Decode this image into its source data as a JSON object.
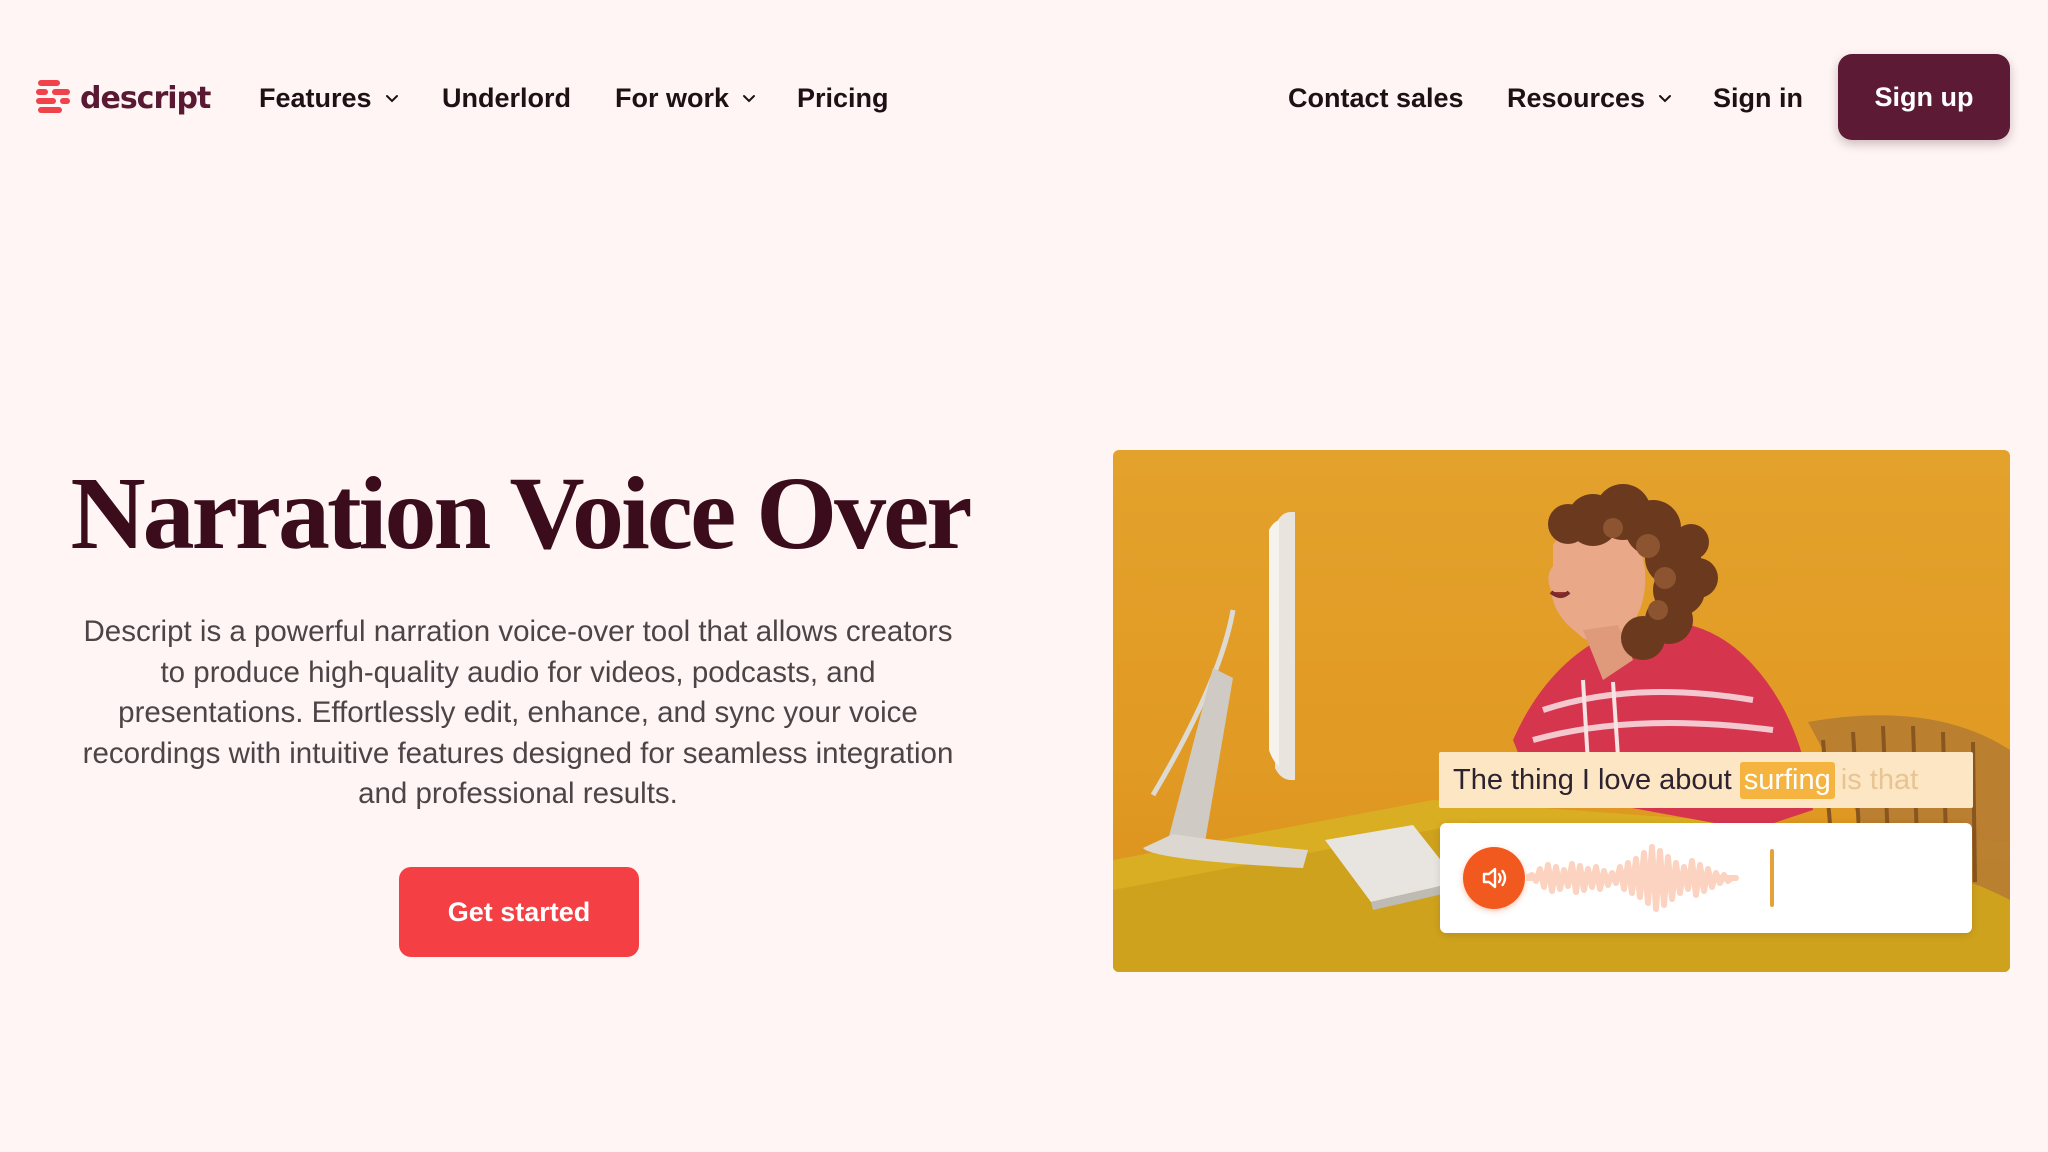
{
  "brand": {
    "name": "descript"
  },
  "nav": {
    "left": [
      {
        "label": "Features",
        "dropdown": true
      },
      {
        "label": "Underlord",
        "dropdown": false
      },
      {
        "label": "For work",
        "dropdown": true
      },
      {
        "label": "Pricing",
        "dropdown": false
      }
    ],
    "right": [
      {
        "label": "Contact sales",
        "dropdown": false
      },
      {
        "label": "Resources",
        "dropdown": true
      },
      {
        "label": "Sign in",
        "dropdown": false
      }
    ],
    "signup_label": "Sign up"
  },
  "hero": {
    "title": "Narration Voice Over",
    "description_lines": [
      "Descript is a powerful narration voice-over tool that allows creators",
      "to produce high-quality audio for videos, podcasts, and",
      "presentations. Effortlessly edit, enhance, and sync your voice",
      "recordings with intuitive features designed for seamless integration",
      "and professional results."
    ],
    "cta_label": "Get started"
  },
  "media": {
    "caption": {
      "spoken": [
        "The",
        "thing",
        "I",
        "love",
        "about"
      ],
      "highlighted": "surfing",
      "upcoming": "is that"
    },
    "icons": {
      "play": "speaker-icon"
    }
  },
  "colors": {
    "background": "#FEF5F4",
    "brand": "#5C1A35",
    "accent": "#F43F45",
    "title": "#3A0C1C",
    "media_bg": "#E3A22C",
    "speaker": "#F2591F",
    "waveform": "#FBD3C0"
  }
}
